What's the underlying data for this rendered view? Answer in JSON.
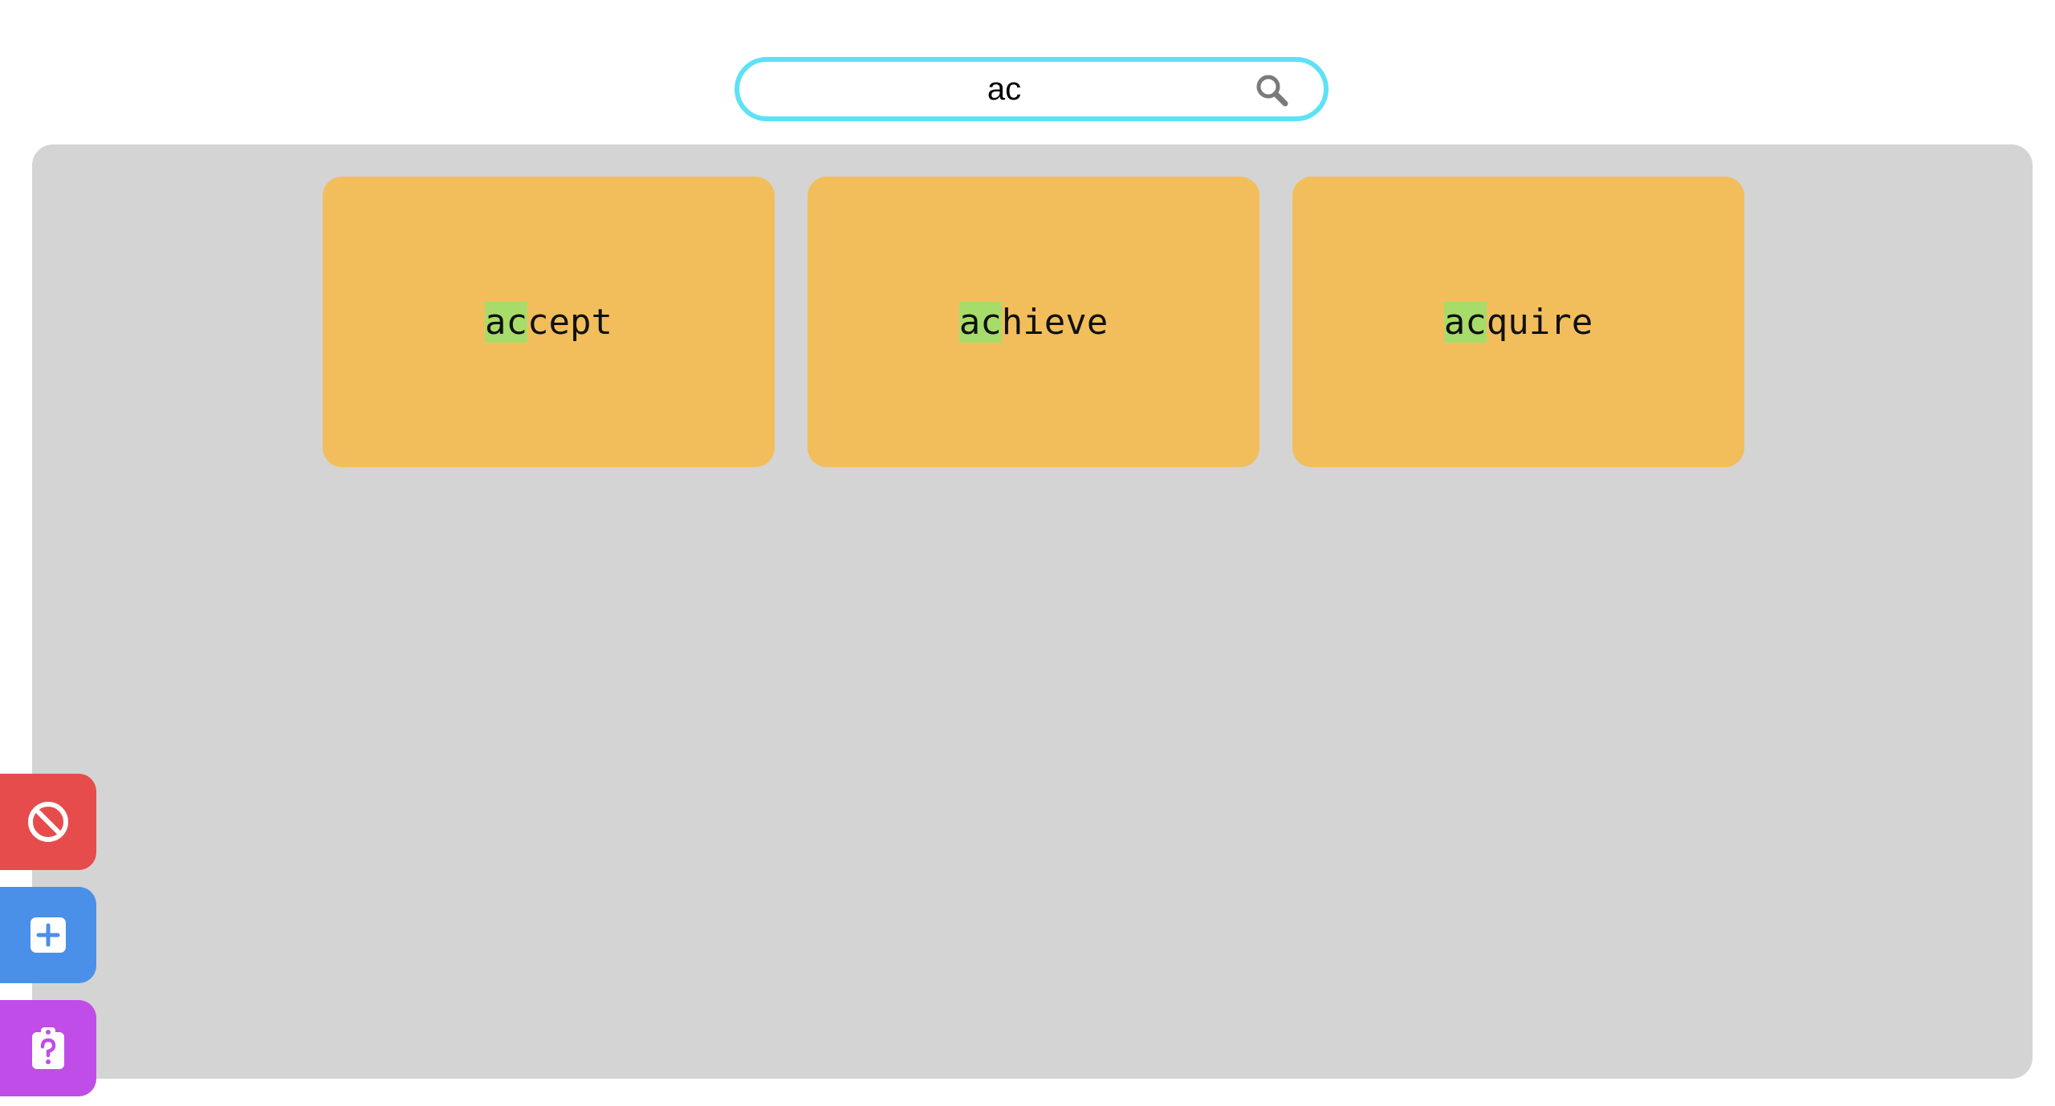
{
  "search": {
    "value": "ac",
    "placeholder": ""
  },
  "cards": [
    {
      "match": "ac",
      "rest": "cept"
    },
    {
      "match": "ac",
      "rest": "hieve"
    },
    {
      "match": "ac",
      "rest": "quire"
    }
  ],
  "side_buttons": [
    {
      "icon": "ban-icon",
      "color": "#e74c4c"
    },
    {
      "icon": "plus-square-icon",
      "color": "#4a90e8"
    },
    {
      "icon": "clipboard-question-icon",
      "color": "#c04de8"
    }
  ],
  "colors": {
    "search_border": "#5ce1f5",
    "board": "#d4d4d4",
    "card": "#f2be5c",
    "highlight": "#a8dc6a"
  }
}
